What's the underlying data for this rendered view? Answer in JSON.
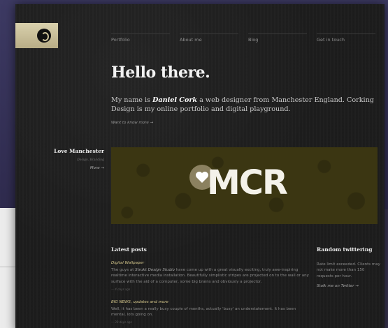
{
  "nav": {
    "items": [
      "Portfolio",
      "About me",
      "Blog",
      "Get in touch"
    ]
  },
  "hero": {
    "title": "Hello there.",
    "intro_prefix": "My name is ",
    "intro_name": "Daniel Cork",
    "intro_suffix": " a web designer from Manchester England. Corking Design is my online portfolio and digital playground.",
    "more_link": "Want to know more →"
  },
  "project": {
    "title": "Love Manchester",
    "meta": "Design, Branding",
    "more_label": "More →",
    "banner_text": "MCR"
  },
  "latest_posts": {
    "heading": "Latest posts",
    "posts": [
      {
        "title": "Digital Wallpaper",
        "body_prefix": "The guys at ",
        "body_em": "Strukt Design Studio",
        "body_suffix": " have come up with a great visually exciting, truly awe-inspiring realtime interactive media installation. Beautifully simplistic stripes are projected on to the wall or any surface with the aid of a computer, some big brains and obviously a projector.",
        "date": "— 4 days ago"
      },
      {
        "title": "BIG NEWS, updates and more",
        "body": "Well, it has been a really busy couple of months, actually 'busy' an understatement. It has been mental, lots going on.",
        "date": "— 30 days ago"
      }
    ]
  },
  "twitter": {
    "heading": "Random twittering",
    "body": "Rate limit exceeded. Clients may not make more than 150 requests per hour.",
    "link": "Stalk me on Twitter →"
  },
  "colors": {
    "site_bg": "#1c1c1c",
    "logo_bg": "#c9bf97",
    "banner_bg": "#3b3612",
    "accent_post_title": "#d7c98d"
  }
}
